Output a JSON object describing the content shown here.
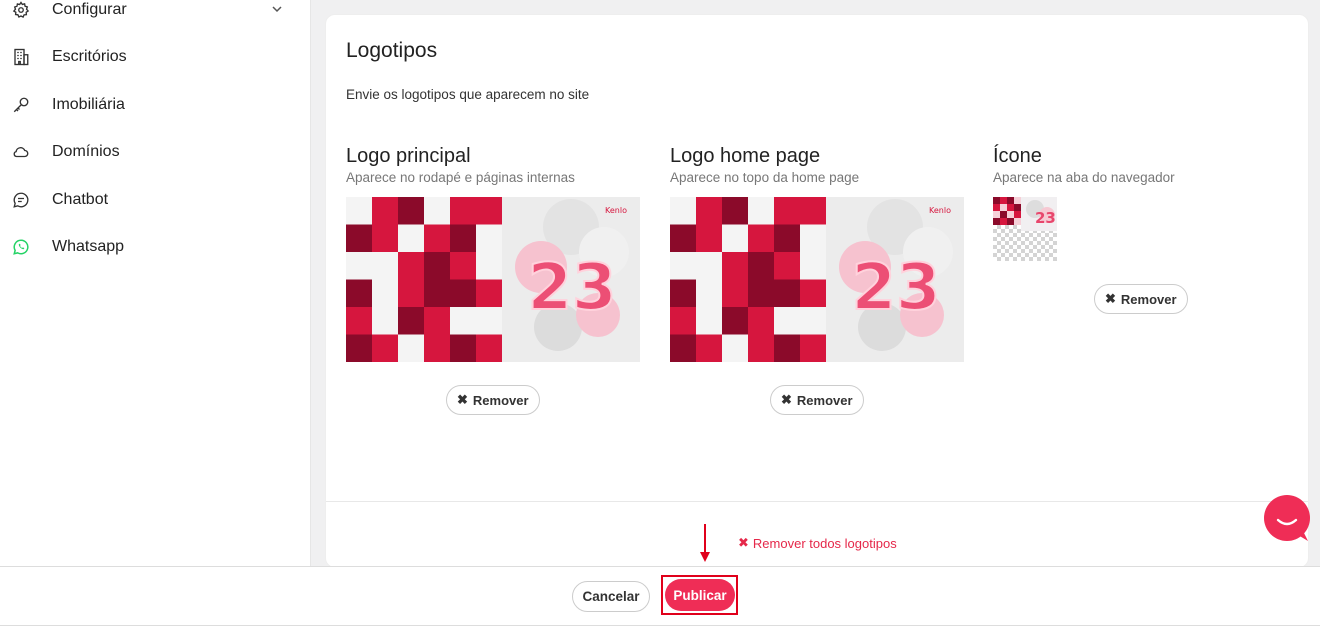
{
  "sidebar": {
    "items": [
      {
        "label": "Configurar",
        "icon": "gear-icon",
        "has_chevron": true
      },
      {
        "label": "Escritórios",
        "icon": "building-icon"
      },
      {
        "label": "Imobiliária",
        "icon": "key-icon"
      },
      {
        "label": "Domínios",
        "icon": "cloud-icon"
      },
      {
        "label": "Chatbot",
        "icon": "chat-icon"
      },
      {
        "label": "Whatsapp",
        "icon": "whatsapp-icon"
      }
    ]
  },
  "card": {
    "title": "Logotipos",
    "description": "Envie os logotipos que aparecem no site",
    "logos": [
      {
        "title": "Logo principal",
        "subtitle": "Aparece no rodapé e páginas internas",
        "remove_label": "Remover"
      },
      {
        "title": "Logo home page",
        "subtitle": "Aparece no topo da home page",
        "remove_label": "Remover"
      },
      {
        "title": "Ícone",
        "subtitle": "Aparece na aba do navegador",
        "remove_label": "Remover"
      }
    ],
    "image_text": {
      "number": "23",
      "brand": "Kenlo"
    },
    "remove_all_label": "Remover todos logotipos"
  },
  "footer": {
    "cancel_label": "Cancelar",
    "publish_label": "Publicar"
  },
  "colors": {
    "accent": "#ef2d56",
    "highlight": "#e0001b",
    "dark_red": "#8b0a2a",
    "red": "#d6163e",
    "whatsapp": "#25d366"
  }
}
